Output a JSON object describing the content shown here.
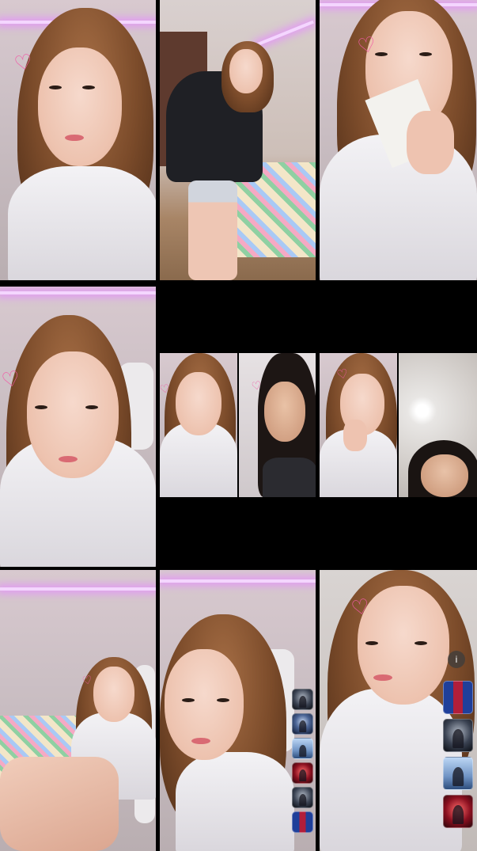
{
  "grid": {
    "tiles": [
      {
        "name": "stream-tile-1"
      },
      {
        "name": "stream-tile-2"
      },
      {
        "name": "stream-tile-3"
      },
      {
        "name": "stream-tile-4"
      },
      {
        "name": "stream-tile-5-split"
      },
      {
        "name": "stream-tile-6-split"
      },
      {
        "name": "stream-tile-7"
      },
      {
        "name": "stream-tile-8"
      },
      {
        "name": "stream-tile-9"
      }
    ]
  },
  "overlay": {
    "heart_glyph": "♡",
    "info_label": "i"
  },
  "colors": {
    "background": "#000000",
    "neon_light": "#f4d6ff",
    "heart": "#f25aa6"
  },
  "icons": [
    "heart-sticker-icon",
    "info-icon",
    "viewer-avatar"
  ]
}
